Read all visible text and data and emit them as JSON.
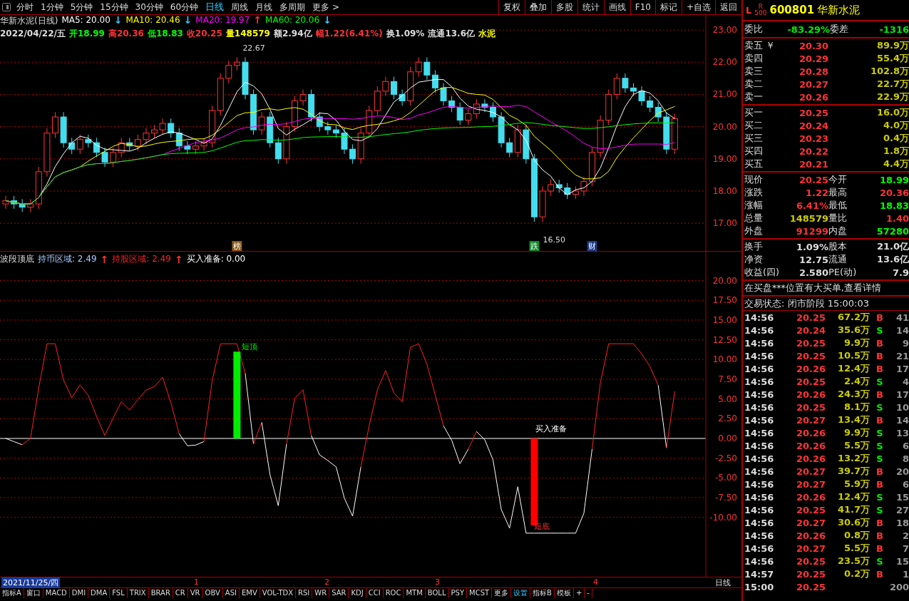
{
  "toolbar": {
    "periods": [
      {
        "label": "分时",
        "selected": false
      },
      {
        "label": "1分钟",
        "selected": false
      },
      {
        "label": "5分钟",
        "selected": false
      },
      {
        "label": "15分钟",
        "selected": false
      },
      {
        "label": "30分钟",
        "selected": false
      },
      {
        "label": "60分钟",
        "selected": false
      },
      {
        "label": "日线",
        "selected": true
      },
      {
        "label": "周线",
        "selected": false
      },
      {
        "label": "月线",
        "selected": false
      },
      {
        "label": "多周期",
        "selected": false
      },
      {
        "label": "更多 >",
        "selected": false
      }
    ],
    "buttons": [
      "复权",
      "叠加",
      "多股",
      "统计",
      "画线",
      "F10",
      "标记",
      "+自选",
      "返回"
    ]
  },
  "chart_header": {
    "title": "华新水泥(日线)",
    "ma": [
      {
        "label": "MA5: 20.00",
        "color": "#ffffff",
        "arrow": {
          "text": "↓",
          "color": "#33ccff"
        }
      },
      {
        "label": "MA10: 20.46",
        "color": "#ffff00",
        "arrow": {
          "text": "↓",
          "color": "#33ccff"
        }
      },
      {
        "label": "MA20: 19.97",
        "color": "#ff00ff",
        "arrow": {
          "text": "↑",
          "color": "#ff3333"
        }
      },
      {
        "label": "MA60: 20.06",
        "color": "#00ff00",
        "arrow": {
          "text": "↓",
          "color": "#33ccff"
        }
      }
    ],
    "quote": [
      {
        "text": "2022/04/22/五",
        "color": "#dddddd"
      },
      {
        "text": "开18.99",
        "color": "#00ff00"
      },
      {
        "text": "高20.36",
        "color": "#ff3333"
      },
      {
        "text": "低18.83",
        "color": "#00ff00"
      },
      {
        "text": "收20.25",
        "color": "#ff3333"
      },
      {
        "text": "量148579",
        "color": "#ffff00"
      },
      {
        "text": "额2.94亿",
        "color": "#dddddd"
      },
      {
        "text": "幅1.22(6.41%)",
        "color": "#ff3333"
      },
      {
        "text": "换1.09%",
        "color": "#dddddd"
      },
      {
        "text": "流通13.6亿",
        "color": "#dddddd"
      },
      {
        "text": "水泥",
        "color": "#ffff00"
      }
    ]
  },
  "price_axis": [
    "23.00",
    "22.00",
    "21.00",
    "20.00",
    "19.00",
    "18.00",
    "17.00"
  ],
  "price_annotations": {
    "high": "22.67",
    "low": "16.50",
    "markers": [
      {
        "label": "榜",
        "color": "#8a5a1a"
      },
      {
        "label": "跌",
        "color": "#0a8a2a"
      },
      {
        "label": "财",
        "color": "#1a3a8a"
      }
    ]
  },
  "indicator": {
    "name": "波段顶底",
    "values": [
      {
        "label": "持币区域: 2.49",
        "color": "#aaccff",
        "arrow": {
          "text": "↑",
          "color": "#ff3333"
        }
      },
      {
        "label": "持股区域: 2.49",
        "color": "#ff2222",
        "arrow": {
          "text": "↑",
          "color": "#ff3333"
        }
      },
      {
        "label": "买入准备: 0.00",
        "color": "#ffffff"
      }
    ],
    "axis": [
      "20.00",
      "17.50",
      "15.00",
      "12.50",
      "10.00",
      "7.50",
      "5.00",
      "2.50",
      "0.00",
      "-2.50",
      "-5.00",
      "-7.50",
      "-10.00"
    ],
    "top_label": "短顶",
    "bottom_label": "短底",
    "ready_label": "买入准备"
  },
  "date_bar": {
    "date": "2021/11/25/四",
    "marks": [
      "1",
      "2",
      "3",
      "4"
    ],
    "period": "日线"
  },
  "indicator_tabs": [
    {
      "label": "指标A",
      "selected": false
    },
    {
      "label": "窗口",
      "selected": false
    },
    {
      "label": "MACD",
      "selected": false
    },
    {
      "label": "DMI",
      "selected": false
    },
    {
      "label": "DMA",
      "selected": false
    },
    {
      "label": "FSL",
      "selected": false
    },
    {
      "label": "TRIX",
      "selected": false
    },
    {
      "label": "BRAR",
      "selected": false
    },
    {
      "label": "CR",
      "selected": false
    },
    {
      "label": "VR",
      "selected": false
    },
    {
      "label": "OBV",
      "selected": false
    },
    {
      "label": "ASI",
      "selected": false
    },
    {
      "label": "EMV",
      "selected": false
    },
    {
      "label": "VOL-TDX",
      "selected": false
    },
    {
      "label": "RSI",
      "selected": false
    },
    {
      "label": "WR",
      "selected": false
    },
    {
      "label": "SAR",
      "selected": false
    },
    {
      "label": "KDJ",
      "selected": false
    },
    {
      "label": "CCI",
      "selected": false
    },
    {
      "label": "ROC",
      "selected": false
    },
    {
      "label": "MTM",
      "selected": false
    },
    {
      "label": "BOLL",
      "selected": false
    },
    {
      "label": "PSY",
      "selected": false
    },
    {
      "label": "MCST",
      "selected": false
    },
    {
      "label": "更多",
      "selected": false
    },
    {
      "label": "设置",
      "selected": true
    },
    {
      "label": "指标B",
      "selected": false
    },
    {
      "label": "模板",
      "selected": false
    },
    {
      "label": "+",
      "selected": false
    },
    {
      "label": "-",
      "selected": false
    }
  ],
  "quote_panel": {
    "flag_l": "L",
    "flag_r": "R",
    "flag_num": "500",
    "code": "600801",
    "name": "华新水泥",
    "ratio": {
      "label": "委比",
      "value": "-83.29%",
      "diff_label": "委差",
      "diff": "-1316"
    },
    "asks": [
      {
        "label": "卖五 ￥",
        "price": "20.30",
        "volume": "89.9万"
      },
      {
        "label": "卖四",
        "price": "20.29",
        "volume": "55.4万"
      },
      {
        "label": "卖三",
        "price": "20.28",
        "volume": "102.8万"
      },
      {
        "label": "卖二",
        "price": "20.27",
        "volume": "22.7万"
      },
      {
        "label": "卖一",
        "price": "20.26",
        "volume": "22.9万"
      }
    ],
    "bids": [
      {
        "label": "买一",
        "price": "20.25",
        "volume": "16.0万"
      },
      {
        "label": "买二",
        "price": "20.24",
        "volume": "4.0万"
      },
      {
        "label": "买三",
        "price": "20.23",
        "volume": "0.4万"
      },
      {
        "label": "买四",
        "price": "20.22",
        "volume": "1.8万"
      },
      {
        "label": "买五",
        "price": "20.21",
        "volume": "4.4万"
      }
    ],
    "stats": [
      {
        "label": "现价",
        "value": "20.25",
        "color": "#ff3333"
      },
      {
        "label": "今开",
        "value": "18.99",
        "color": "#00ff00"
      },
      {
        "label": "涨跌",
        "value": "1.22",
        "color": "#ff3333"
      },
      {
        "label": "最高",
        "value": "20.36",
        "color": "#ff3333"
      },
      {
        "label": "涨幅",
        "value": "6.41%",
        "color": "#ff3333"
      },
      {
        "label": "最低",
        "value": "18.83",
        "color": "#00ff00"
      },
      {
        "label": "总量",
        "value": "148579",
        "color": "#cccc00"
      },
      {
        "label": "量比",
        "value": "1.40",
        "color": "#ff3333"
      },
      {
        "label": "外盘",
        "value": "91299",
        "color": "#ff3333"
      },
      {
        "label": "内盘",
        "value": "57280",
        "color": "#00ff00"
      }
    ],
    "info": [
      {
        "label": "换手",
        "value": "1.09%",
        "label2": "股本",
        "value2": "21.0亿"
      },
      {
        "label": "净资",
        "value": "12.75",
        "label2": "流通",
        "value2": "13.6亿"
      },
      {
        "label": "收益(四)",
        "value": "2.580",
        "label2": "PE(动)",
        "value2": "7.9"
      }
    ],
    "notice": "在买盘***位置有大买单,查看详情",
    "status": "交易状态: 闭市阶段 15:00:03",
    "ticks": [
      {
        "time": "14:56",
        "price": "20.25",
        "volume": "67.2万",
        "side": "B",
        "kind": "buy",
        "count": "41"
      },
      {
        "time": "14:56",
        "price": "20.24",
        "volume": "35.6万",
        "side": "S",
        "kind": "sell",
        "count": "14"
      },
      {
        "time": "14:56",
        "price": "20.25",
        "volume": "9.9万",
        "side": "B",
        "kind": "buy",
        "count": "9"
      },
      {
        "time": "14:56",
        "price": "20.25",
        "volume": "10.5万",
        "side": "B",
        "kind": "buy",
        "count": "21"
      },
      {
        "time": "14:56",
        "price": "20.26",
        "volume": "12.4万",
        "side": "B",
        "kind": "buy",
        "count": "17"
      },
      {
        "time": "14:56",
        "price": "20.25",
        "volume": "2.4万",
        "side": "S",
        "kind": "sell",
        "count": "4"
      },
      {
        "time": "14:56",
        "price": "20.26",
        "volume": "24.3万",
        "side": "B",
        "kind": "buy",
        "count": "17"
      },
      {
        "time": "14:56",
        "price": "20.25",
        "volume": "8.1万",
        "side": "S",
        "kind": "sell",
        "count": "10"
      },
      {
        "time": "14:56",
        "price": "20.27",
        "volume": "13.4万",
        "side": "B",
        "kind": "buy",
        "count": "14"
      },
      {
        "time": "14:56",
        "price": "20.26",
        "volume": "9.9万",
        "side": "S",
        "kind": "sell",
        "count": "13"
      },
      {
        "time": "14:56",
        "price": "20.26",
        "volume": "5.5万",
        "side": "S",
        "kind": "sell",
        "count": "6"
      },
      {
        "time": "14:56",
        "price": "20.26",
        "volume": "13.2万",
        "side": "S",
        "kind": "sell",
        "count": "8"
      },
      {
        "time": "14:56",
        "price": "20.27",
        "volume": "39.7万",
        "side": "B",
        "kind": "buy",
        "count": "20"
      },
      {
        "time": "14:56",
        "price": "20.27",
        "volume": "5.9万",
        "side": "B",
        "kind": "buy",
        "count": "6"
      },
      {
        "time": "14:56",
        "price": "20.26",
        "volume": "12.4万",
        "side": "S",
        "kind": "sell",
        "count": "15"
      },
      {
        "time": "14:56",
        "price": "20.25",
        "volume": "41.7万",
        "side": "S",
        "kind": "sell",
        "count": "27"
      },
      {
        "time": "14:56",
        "price": "20.27",
        "volume": "30.6万",
        "side": "B",
        "kind": "buy",
        "count": "18"
      },
      {
        "time": "14:56",
        "price": "20.26",
        "volume": "0.8万",
        "side": "B",
        "kind": "buy",
        "count": "2"
      },
      {
        "time": "14:56",
        "price": "20.27",
        "volume": "5.5万",
        "side": "B",
        "kind": "buy",
        "count": "7"
      },
      {
        "time": "14:56",
        "price": "20.25",
        "volume": "23.5万",
        "side": "S",
        "kind": "sell",
        "count": "15"
      },
      {
        "time": "14:57",
        "price": "20.25",
        "volume": "0.2万",
        "side": "B",
        "kind": "buy",
        "count": "1"
      },
      {
        "time": "15:00",
        "price": "20.25",
        "kind": "none",
        "count": "200"
      }
    ]
  }
}
